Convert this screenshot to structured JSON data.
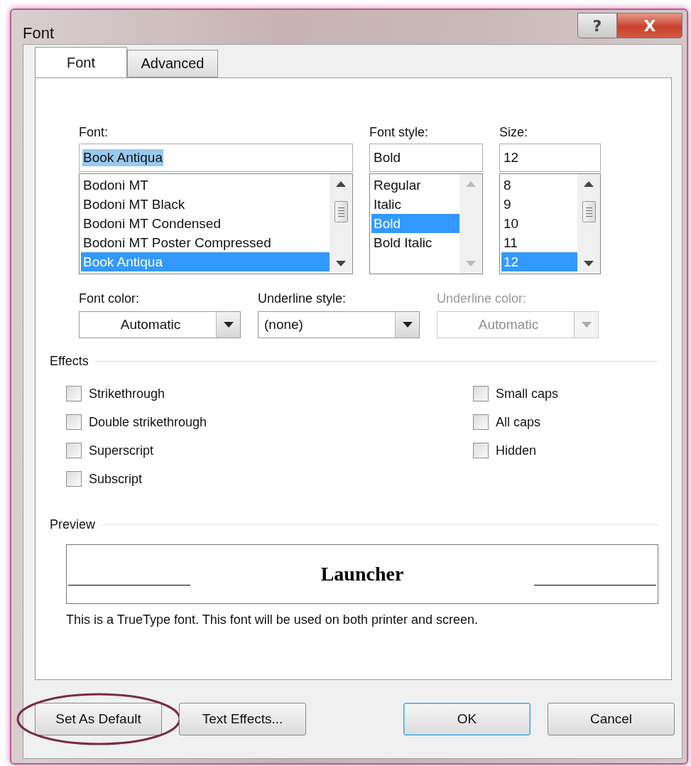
{
  "window": {
    "title": "Font",
    "controls": [
      "?",
      "X"
    ]
  },
  "tabs": [
    {
      "label": "Font",
      "selected": true
    },
    {
      "label": "Advanced",
      "selected": false
    }
  ],
  "pickers": [
    {
      "label": "Font:",
      "value": "Book Antiqua",
      "value_selected": true,
      "scrollable": true,
      "items": [
        {
          "text": "Bodoni MT",
          "selected": false
        },
        {
          "text": "Bodoni MT Black",
          "selected": false
        },
        {
          "text": "Bodoni MT Condensed",
          "selected": false
        },
        {
          "text": "Bodoni MT Poster Compressed",
          "selected": false
        },
        {
          "text": "Book Antiqua",
          "selected": true
        }
      ]
    },
    {
      "label": "Font style:",
      "value": "Bold",
      "value_selected": false,
      "scrollable": false,
      "items": [
        {
          "text": "Regular",
          "selected": false
        },
        {
          "text": "Italic",
          "selected": false
        },
        {
          "text": "Bold",
          "selected": true
        },
        {
          "text": "Bold Italic",
          "selected": false
        }
      ]
    },
    {
      "label": "Size:",
      "value": "12",
      "value_selected": false,
      "scrollable": true,
      "items": [
        {
          "text": "8",
          "selected": false
        },
        {
          "text": "9",
          "selected": false
        },
        {
          "text": "10",
          "selected": false
        },
        {
          "text": "11",
          "selected": false
        },
        {
          "text": "12",
          "selected": true
        }
      ]
    }
  ],
  "dropdowns": [
    {
      "label": "Font color:",
      "value": "Automatic",
      "kind": "color",
      "disabled": false
    },
    {
      "label": "Underline style:",
      "value": "(none)",
      "kind": "style",
      "disabled": false
    },
    {
      "label": "Underline color:",
      "value": "Automatic",
      "kind": "color",
      "disabled": true
    }
  ],
  "effects": {
    "title": "Effects",
    "columns": [
      [
        {
          "label": "Strikethrough",
          "checked": false
        },
        {
          "label": "Double strikethrough",
          "checked": false
        },
        {
          "label": "Superscript",
          "checked": false
        },
        {
          "label": "Subscript",
          "checked": false
        }
      ],
      [
        {
          "label": "Small caps",
          "checked": false
        },
        {
          "label": "All caps",
          "checked": false
        },
        {
          "label": "Hidden",
          "checked": false
        }
      ]
    ]
  },
  "preview": {
    "title": "Preview",
    "sample": "Launcher",
    "description": "This is a TrueType font. This font will be used on both printer and screen."
  },
  "buttons": [
    {
      "label": "Set As Default",
      "default": false,
      "circled": true
    },
    {
      "label": "Text Effects...",
      "default": false,
      "circled": false
    },
    {
      "label": "OK",
      "default": true,
      "circled": false
    },
    {
      "label": "Cancel",
      "default": false,
      "circled": false
    }
  ]
}
